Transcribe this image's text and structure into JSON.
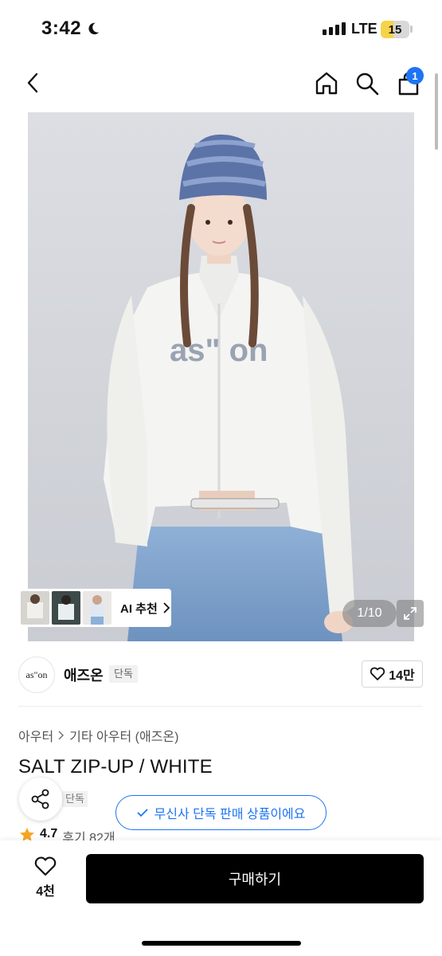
{
  "status_bar": {
    "time": "3:42",
    "network": "LTE",
    "battery": "15",
    "icons": [
      "moon-icon",
      "signal-icon"
    ]
  },
  "nav": {
    "icons": [
      "back-icon",
      "home-icon",
      "search-icon",
      "cart-icon"
    ],
    "cart_count": "1"
  },
  "gallery": {
    "counter": "1/10",
    "ai_label": "AI 추천",
    "expand_icon": "expand-icon",
    "image_print_text": "as\" on"
  },
  "brand": {
    "logo_text": "as\"on",
    "name": "애즈온",
    "badge": "단독",
    "like_count": "14만"
  },
  "breadcrumb": {
    "category": "아우터",
    "subcategory": "기타 아우터 (애즈온)"
  },
  "product": {
    "title": "SALT ZIP-UP / WHITE",
    "tag": "단독",
    "exclusive_notice": "무신사 단독 판매 상품이에요",
    "rating": "4.7",
    "review_text": "후기 82개"
  },
  "bottom_bar": {
    "wish_count": "4천",
    "buy_label": "구매하기"
  },
  "colors": {
    "accent_blue": "#1d74f5",
    "buy_button": "#000000",
    "battery": "#f5d34a",
    "star": "#f5a623"
  }
}
